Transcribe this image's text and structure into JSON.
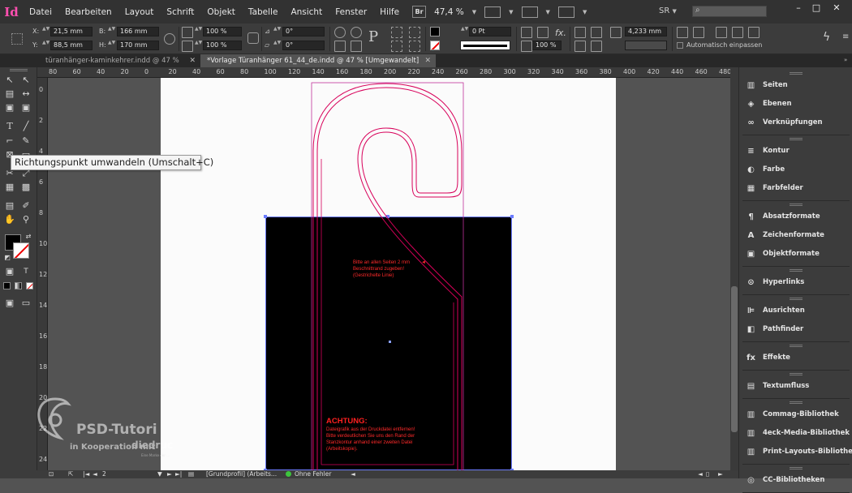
{
  "menubar": {
    "logo": "Id",
    "items": [
      "Datei",
      "Bearbeiten",
      "Layout",
      "Schrift",
      "Objekt",
      "Tabelle",
      "Ansicht",
      "Fenster",
      "Hilfe"
    ],
    "bridge_label": "Br",
    "zoom": "47,4 %",
    "workspace": "SR",
    "search_placeholder": "",
    "window_buttons": [
      "–",
      "□",
      "✕"
    ]
  },
  "control": {
    "x_label": "X:",
    "x_value": "21,5 mm",
    "y_label": "Y:",
    "y_value": "88,5 mm",
    "w_label": "B:",
    "w_value": "166 mm",
    "h_label": "H:",
    "h_value": "170 mm",
    "scale_x": "100 %",
    "scale_y": "100 %",
    "rotate": "0°",
    "shear": "0°",
    "stroke_weight": "0 Pt",
    "opacity": "100 %",
    "offset": "4,233 mm",
    "autofit_label": "Automatisch einpassen"
  },
  "tabs": [
    {
      "label": "türanhänger-kaminkehrer.indd @ 47 %",
      "active": false
    },
    {
      "label": "*Vorlage Türanhänger 61_44_de.indd @ 47 % [Umgewandelt]",
      "active": true
    }
  ],
  "tooltip": "Richtungspunkt umwandeln (Umschalt+C)",
  "ruler": {
    "top": [
      "80",
      "60",
      "40",
      "20",
      "0",
      "20",
      "40",
      "60",
      "80",
      "100",
      "120",
      "140",
      "160",
      "180",
      "200",
      "220",
      "240",
      "260",
      "280",
      "300",
      "320",
      "340",
      "360",
      "380",
      "400",
      "420",
      "440",
      "460",
      "480"
    ],
    "left": [
      "0",
      "2",
      "4",
      "6",
      "8",
      "10",
      "12",
      "14",
      "16",
      "18",
      "20",
      "22",
      "24"
    ]
  },
  "document": {
    "note_lines": [
      "Bitte an allen Seiten 2 mm",
      "Beschnittrand zugeben!",
      "(Gestrichelte Linie)"
    ],
    "warning_heading": "ACHTUNG:",
    "warning_lines": [
      "Dateigrafik aus der Druckdatei entfernen!",
      "Bitte verdeutlichen Sie uns den Rand der",
      "Stanzkontur anhand einer zweiten Datei",
      "(Arbeitskopie)."
    ]
  },
  "panels": {
    "groups": [
      [
        {
          "label": "Seiten",
          "icon": "pages-icon"
        },
        {
          "label": "Ebenen",
          "icon": "layers-icon"
        },
        {
          "label": "Verknüpfungen",
          "icon": "links-icon"
        }
      ],
      [
        {
          "label": "Kontur",
          "icon": "stroke-icon"
        },
        {
          "label": "Farbe",
          "icon": "color-icon"
        },
        {
          "label": "Farbfelder",
          "icon": "swatches-icon"
        }
      ],
      [
        {
          "label": "Absatzformate",
          "icon": "paragraph-styles-icon"
        },
        {
          "label": "Zeichenformate",
          "icon": "character-styles-icon"
        },
        {
          "label": "Objektformate",
          "icon": "object-styles-icon"
        }
      ],
      [
        {
          "label": "Hyperlinks",
          "icon": "hyperlinks-icon"
        }
      ],
      [
        {
          "label": "Ausrichten",
          "icon": "align-icon"
        },
        {
          "label": "Pathfinder",
          "icon": "pathfinder-icon"
        }
      ],
      [
        {
          "label": "Effekte",
          "icon": "effects-icon"
        }
      ],
      [
        {
          "label": "Textumfluss",
          "icon": "text-wrap-icon"
        }
      ],
      [
        {
          "label": "Commag-Bibliothek",
          "icon": "library-icon"
        },
        {
          "label": "4eck-Media-Bibliothek",
          "icon": "library-icon"
        },
        {
          "label": "Print-Layouts-Bibliothek",
          "icon": "library-icon"
        }
      ],
      [
        {
          "label": "CC-Bibliotheken",
          "icon": "cc-libraries-icon"
        }
      ]
    ]
  },
  "status": {
    "page": "2",
    "profile": "[Grundprofil] (Arbeits...",
    "preflight": "Ohne Fehler"
  },
  "watermark": {
    "title": "PSD-Tutori",
    "sub": "in Kooperation mit",
    "brand": "diedruc",
    "tiny": "Eine Marke der ..."
  },
  "colors": {
    "accent": "#ff4fb0",
    "dieline": "#d8005a",
    "frame": "#6b7cff",
    "warning": "#ff2020"
  }
}
